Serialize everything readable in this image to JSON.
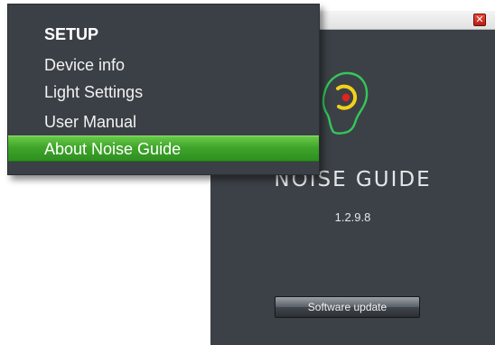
{
  "window": {
    "close_glyph": "✕",
    "brand_name": "NOISE GUIDE",
    "version": "1.2.9.8",
    "software_update_label": "Software update",
    "logo_icon": "ear-icon",
    "colors": {
      "background": "#3c4147",
      "logo_outline": "#34c759",
      "logo_ring": "#f0d21a",
      "logo_dot": "#e3231b"
    }
  },
  "menu": {
    "header": "SETUP",
    "items": [
      {
        "label": "Device info"
      },
      {
        "label": "Light Settings"
      },
      {
        "label": "User Manual"
      },
      {
        "label": "About Noise Guide",
        "highlighted": true
      }
    ],
    "colors": {
      "background": "#3b4046",
      "highlight": "#3fa52a"
    }
  }
}
